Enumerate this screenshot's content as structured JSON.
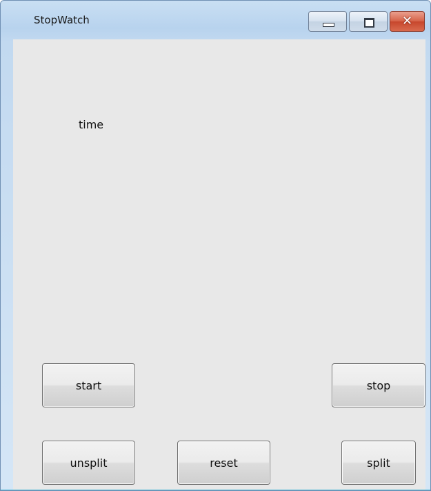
{
  "window": {
    "title": "StopWatch",
    "close_glyph": "✕"
  },
  "icons": {
    "minimize": "minimize-icon",
    "maximize": "maximize-icon",
    "close": "close-icon"
  },
  "content": {
    "time_label": "time"
  },
  "buttons": {
    "start": "start",
    "stop": "stop",
    "unsplit": "unsplit",
    "reset": "reset",
    "split": "split"
  },
  "colors": {
    "client_background": "#e8e8e8",
    "close_button": "#c7472d",
    "frame": "#c2d9f0"
  }
}
